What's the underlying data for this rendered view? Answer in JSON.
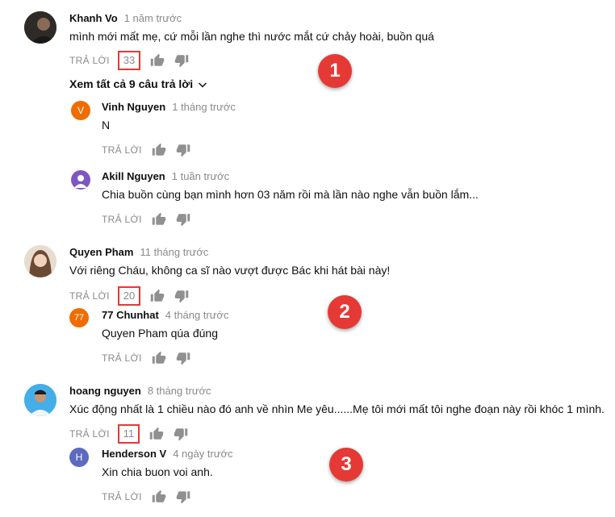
{
  "reply_label": "TRẢ LỜI",
  "threads": [
    {
      "author": "Khanh Vo",
      "time": "1 năm trước",
      "text": "mình mới mất mẹ, cứ mỗi lần nghe thì nước mắt cứ chảy hoài, buồn quá",
      "likes": "33",
      "view_replies": "Xem tất cả 9 câu trả lời",
      "marker": "1",
      "replies": [
        {
          "author": "Vinh Nguyen",
          "time": "1 tháng trước",
          "text": "N",
          "initial": "V",
          "avatar_color": "#ef6c00"
        },
        {
          "author": "Akill Nguyen",
          "time": "1 tuần trước",
          "text": "Chia buồn cùng bạn mình hơn 03 năm rồi mà lần nào nghe vẫn buồn lắm...",
          "initial": "",
          "avatar_color": "#7e57c2"
        }
      ]
    },
    {
      "author": "Quyen Pham",
      "time": "11 tháng trước",
      "text": "Với riêng Cháu, không ca sĩ nào vượt được Bác khi hát bài này!",
      "likes": "20",
      "marker": "2",
      "replies": [
        {
          "author": "77 Chunhat",
          "time": "4 tháng trước",
          "text": "Quyen Pham qúa đúng",
          "initial": "77",
          "avatar_color": "#ef6c00"
        }
      ]
    },
    {
      "author": "hoang nguyen",
      "time": "8 tháng trước",
      "text": "Xúc động nhất là 1 chiều nào đó anh về nhìn Me yêu......Mẹ tôi mới mất tôi nghe đoạn này rồi khóc 1 mình.",
      "likes": "11",
      "marker": "3",
      "replies": [
        {
          "author": "Henderson V",
          "time": "4 ngày trước",
          "text": "Xin chia buon voi anh.",
          "initial": "H",
          "avatar_color": "#5c6bc0"
        }
      ]
    }
  ]
}
